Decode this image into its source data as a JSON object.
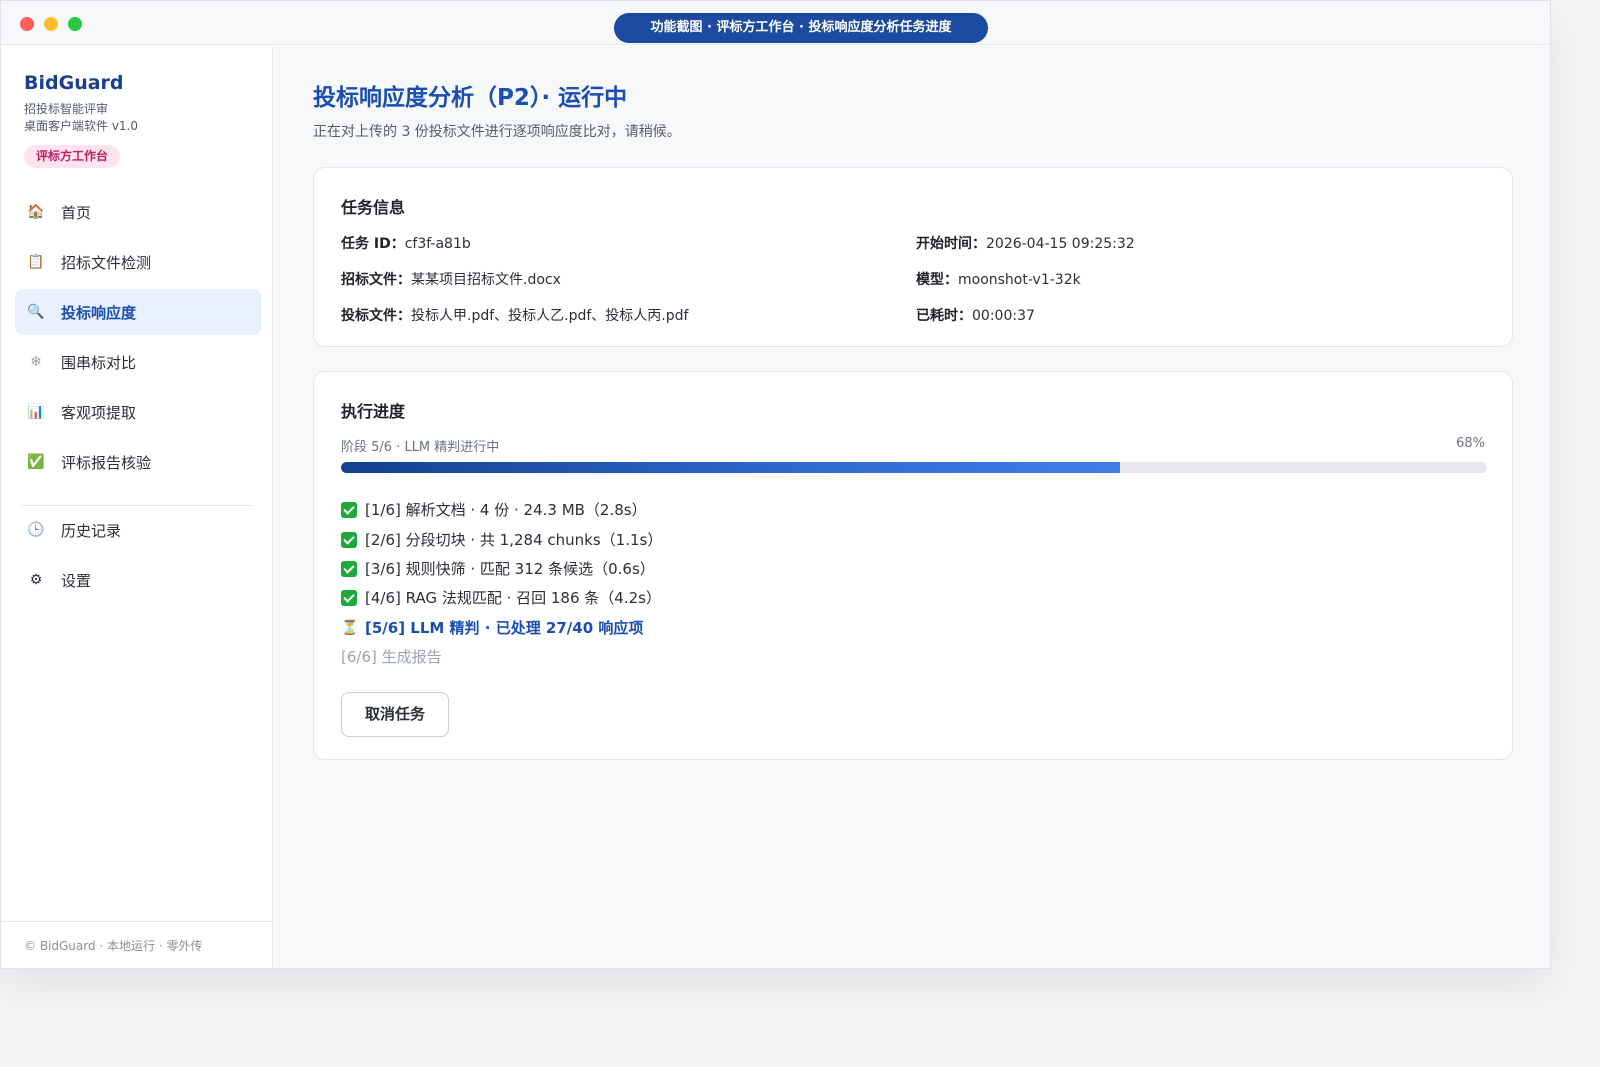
{
  "window": {
    "title": "功能截图 · 评标方工作台 · 投标响应度分析任务进度"
  },
  "sidebar": {
    "brand": "BidGuard",
    "subtitle1": "招投标智能评审",
    "subtitle2": "桌面客户端软件 v1.0",
    "role_badge": "评标方工作台",
    "items": [
      {
        "label": "首页",
        "icon": "house-icon",
        "active": false
      },
      {
        "label": "招标文件检测",
        "icon": "clipboard-icon",
        "active": false
      },
      {
        "label": "投标响应度",
        "icon": "magnifier-icon",
        "active": true
      },
      {
        "label": "围串标对比",
        "icon": "snowflake-icon",
        "active": false
      },
      {
        "label": "客观项提取",
        "icon": "bar-chart-icon",
        "active": false
      },
      {
        "label": "评标报告核验",
        "icon": "check-box-icon",
        "active": false
      },
      {
        "label": "历史记录",
        "icon": "clock-icon",
        "active": false
      },
      {
        "label": "设置",
        "icon": "gear-icon",
        "active": false
      }
    ],
    "footer": "© BidGuard · 本地运行 · 零外传"
  },
  "main": {
    "title": "投标响应度分析（P2）· 运行中",
    "subtitle": "正在对上传的 3 份投标文件进行逐项响应度比对，请稍候。",
    "task_info": {
      "card_title": "任务信息",
      "task_id_label": "任务 ID：",
      "task_id": "cf3f-a81b",
      "tender_file_label": "招标文件：",
      "tender_file": "某某项目招标文件.docx",
      "bid_files_label": "投标文件：",
      "bid_files": "投标人甲.pdf、投标人乙.pdf、投标人丙.pdf",
      "start_time_label": "开始时间：",
      "start_time": "2026-04-15 09:25:32",
      "model_label": "模型：",
      "model": "moonshot-v1-32k",
      "elapsed_label": "已耗时：",
      "elapsed": "00:00:37"
    },
    "progress": {
      "card_title": "执行进度",
      "stage_label": "阶段 5/6 · LLM 精判进行中",
      "percent_label": "68%",
      "percent": 68,
      "steps": [
        {
          "text": "[1/6] 解析文档 · 4 份 · 24.3 MB（2.8s）",
          "status": "done"
        },
        {
          "text": "[2/6] 分段切块 · 共 1,284 chunks（1.1s）",
          "status": "done"
        },
        {
          "text": "[3/6] 规则快筛 · 匹配 312 条候选（0.6s）",
          "status": "done"
        },
        {
          "text": "[4/6] RAG 法规匹配 · 召回 186 条（4.2s）",
          "status": "done"
        },
        {
          "text": "[5/6] LLM 精判 · 已处理 27/40 响应项",
          "status": "running"
        },
        {
          "text": "[6/6] 生成报告",
          "status": "pending"
        }
      ],
      "cancel_label": "取消任务"
    }
  }
}
